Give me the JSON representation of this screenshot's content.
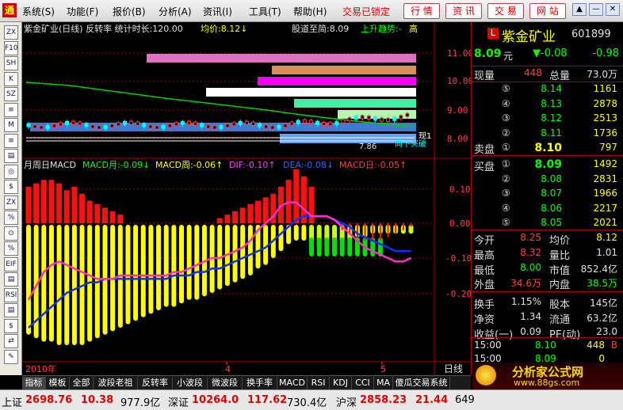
{
  "menu": {
    "logo": "通",
    "items": [
      "系统(S)",
      "功能(F)",
      "报价(B)",
      "分析(A)",
      "资讯(I)",
      "工具(T)",
      "帮助(H)"
    ],
    "lock_text": "交易已锁定",
    "buttons": [
      "行 情",
      "资 讯",
      "交 易",
      "网 站"
    ],
    "win_buttons": [
      "▲",
      "—",
      "✕"
    ]
  },
  "toolbar_icons": [
    "ZX",
    "F10",
    "SH",
    "K",
    "SZ",
    "≡",
    "M",
    "≡",
    "▤",
    "◎",
    "$",
    "ZX",
    "%",
    "⊙",
    "%",
    "EIF",
    "▤",
    "RSI",
    "▤",
    "$",
    "⇄",
    "✎"
  ],
  "chart_header": {
    "title": "紫金矿业(日线) 反转率 统计时长:120.00",
    "avg": "均价:8.12↓",
    "sell_to": "股道至简:8.09",
    "trend": "上升趋势:-",
    "extra": "高"
  },
  "price_axis": [
    "11.00",
    "10.00",
    "9.00",
    "8.00"
  ],
  "price_labels": [
    "现1",
    "7.86",
    "向下突破"
  ],
  "macd_header": {
    "name": "月周日MACD",
    "month": "MACD月:-0.09↓",
    "week": "MACD周:-0.06↑",
    "dif": "DIF:-0.10↑",
    "dea": "DEA:-0.08↓",
    "day": "MACD日:-0.05↑"
  },
  "macd_axis": [
    "0.10",
    "0.00",
    "-0.10",
    "-0.20"
  ],
  "time_axis": [
    "2010年",
    "4",
    "5"
  ],
  "time_mode": "日线",
  "chart_data": {
    "type": "bar",
    "title": "月周日MACD",
    "ylim": [
      -0.4,
      0.15
    ],
    "red_bars": [
      0.1,
      0.11,
      0.12,
      0.12,
      0.11,
      0.09,
      0.1,
      0.08,
      0.06,
      0.05,
      0.04,
      0.03,
      0.02,
      0.0,
      0.0,
      0.0,
      0.0,
      0.0,
      0.0,
      0.0,
      0.0,
      0.0,
      0.0,
      0.0,
      0.0,
      0.01,
      0.02,
      0.03,
      0.04,
      0.05,
      0.06,
      0.07,
      0.08,
      0.1,
      0.12,
      0.15,
      0.13,
      0.1,
      0.0,
      0.0,
      0.0,
      -0.02,
      -0.03,
      -0.04,
      -0.05,
      -0.05,
      -0.05,
      -0.04,
      -0.03,
      -0.02,
      -0.01
    ],
    "yellow_bars": [
      -0.32,
      -0.33,
      -0.34,
      -0.34,
      -0.35,
      -0.35,
      -0.35,
      -0.35,
      -0.34,
      -0.33,
      -0.32,
      -0.31,
      -0.3,
      -0.29,
      -0.28,
      -0.27,
      -0.26,
      -0.25,
      -0.24,
      -0.24,
      -0.23,
      -0.22,
      -0.22,
      -0.21,
      -0.2,
      -0.19,
      -0.18,
      -0.17,
      -0.16,
      -0.15,
      -0.13,
      -0.12,
      -0.1,
      -0.08,
      -0.06,
      -0.05,
      -0.05,
      -0.06,
      -0.07,
      -0.07,
      -0.07,
      -0.06,
      -0.05,
      -0.04,
      -0.04,
      -0.03,
      -0.03,
      -0.03,
      -0.03,
      -0.03,
      -0.03
    ],
    "dif": [
      -0.22,
      -0.18,
      -0.14,
      -0.12,
      -0.11,
      -0.12,
      -0.13,
      -0.14,
      -0.15,
      -0.16,
      -0.16,
      -0.16,
      -0.15,
      -0.15,
      -0.15,
      -0.15,
      -0.15,
      -0.15,
      -0.15,
      -0.14,
      -0.14,
      -0.13,
      -0.12,
      -0.11,
      -0.1,
      -0.1,
      -0.09,
      -0.08,
      -0.07,
      -0.05,
      -0.02,
      0.0,
      0.02,
      0.05,
      0.06,
      0.06,
      0.04,
      0.02,
      0.02,
      0.02,
      0.01,
      -0.01,
      -0.03,
      -0.05,
      -0.07,
      -0.08,
      -0.09,
      -0.1,
      -0.11,
      -0.11,
      -0.1
    ],
    "dea": [
      -0.3,
      -0.28,
      -0.26,
      -0.24,
      -0.22,
      -0.2,
      -0.19,
      -0.18,
      -0.17,
      -0.17,
      -0.16,
      -0.16,
      -0.16,
      -0.16,
      -0.16,
      -0.16,
      -0.16,
      -0.16,
      -0.16,
      -0.15,
      -0.15,
      -0.15,
      -0.14,
      -0.14,
      -0.13,
      -0.13,
      -0.12,
      -0.11,
      -0.1,
      -0.09,
      -0.08,
      -0.07,
      -0.05,
      -0.03,
      -0.01,
      0.01,
      0.02,
      0.02,
      0.02,
      0.02,
      0.01,
      0.0,
      -0.01,
      -0.03,
      -0.04,
      -0.05,
      -0.06,
      -0.07,
      -0.08,
      -0.08,
      -0.08
    ]
  },
  "quote": {
    "name": "紫金矿业",
    "code": "601899",
    "price": "8.09",
    "unit": "元",
    "change": "▼-0.08",
    "pct": "-0.98",
    "now_vol_label": "现量",
    "now_vol": "448",
    "total_label": "总量",
    "total": "73.0万",
    "sell_label": "卖盘",
    "buy_label": "买盘",
    "sells": [
      {
        "idx": "⑤",
        "price": "8.14",
        "vol": "1161"
      },
      {
        "idx": "④",
        "price": "8.13",
        "vol": "2878"
      },
      {
        "idx": "③",
        "price": "8.12",
        "vol": "2513"
      },
      {
        "idx": "②",
        "price": "8.11",
        "vol": "1736"
      },
      {
        "idx": "①",
        "price": "8.10",
        "vol": "797"
      }
    ],
    "buys": [
      {
        "idx": "①",
        "price": "8.09",
        "vol": "1492"
      },
      {
        "idx": "②",
        "price": "8.08",
        "vol": "2831"
      },
      {
        "idx": "③",
        "price": "8.07",
        "vol": "1966"
      },
      {
        "idx": "④",
        "price": "8.06",
        "vol": "2217"
      },
      {
        "idx": "⑤",
        "price": "8.05",
        "vol": "2021"
      }
    ],
    "stats": [
      {
        "l1": "今开",
        "v1": "8.25",
        "c1": "red",
        "l2": "均价",
        "v2": "8.12",
        "c2": "yellow"
      },
      {
        "l1": "最高",
        "v1": "8.32",
        "c1": "red",
        "l2": "量比",
        "v2": "1.01",
        "c2": "white"
      },
      {
        "l1": "最低",
        "v1": "8.00",
        "c1": "green",
        "l2": "市值",
        "v2": "852.4亿",
        "c2": "white"
      },
      {
        "l1": "外盘",
        "v1": "34.6万",
        "c1": "red",
        "l2": "内盘",
        "v2": "38.5万",
        "c2": "green"
      },
      {
        "l1": "换手",
        "v1": "1.15%",
        "c1": "white",
        "l2": "股本",
        "v2": "145亿",
        "c2": "white"
      },
      {
        "l1": "净资",
        "v1": "1.34",
        "c1": "white",
        "l2": "流通",
        "v2": "63.2亿",
        "c2": "white"
      },
      {
        "l1": "收益(一)",
        "v1": "0.09",
        "c1": "white",
        "l2": "PE(动)",
        "v2": "23.0",
        "c2": "white"
      }
    ],
    "ticks": [
      {
        "time": "15:00",
        "price": "8.10",
        "vol": "448",
        "flag": "B"
      },
      {
        "time": "15:00",
        "price": "8.09",
        "vol": "0",
        "flag": ""
      }
    ],
    "watermark": "分析家公式网",
    "watermark_url": "www.88gs.com"
  },
  "tabs": [
    "指标",
    "模板",
    "全部",
    "波段老祖",
    "反转率",
    "小波段",
    "微波段",
    "换手率",
    "MACD",
    "RSI",
    "KDJ",
    "CCI",
    "MA",
    "傻瓜交易系统"
  ],
  "status": [
    {
      "label": "上证",
      "price": "2698.76",
      "chg": "10.38",
      "amt": "977.9亿"
    },
    {
      "label": "深证",
      "price": "10264.0",
      "chg": "117.62",
      "amt": "730.4亿"
    },
    {
      "label": "沪深",
      "price": "2858.23",
      "chg": "21.44",
      "amt": "649"
    }
  ]
}
